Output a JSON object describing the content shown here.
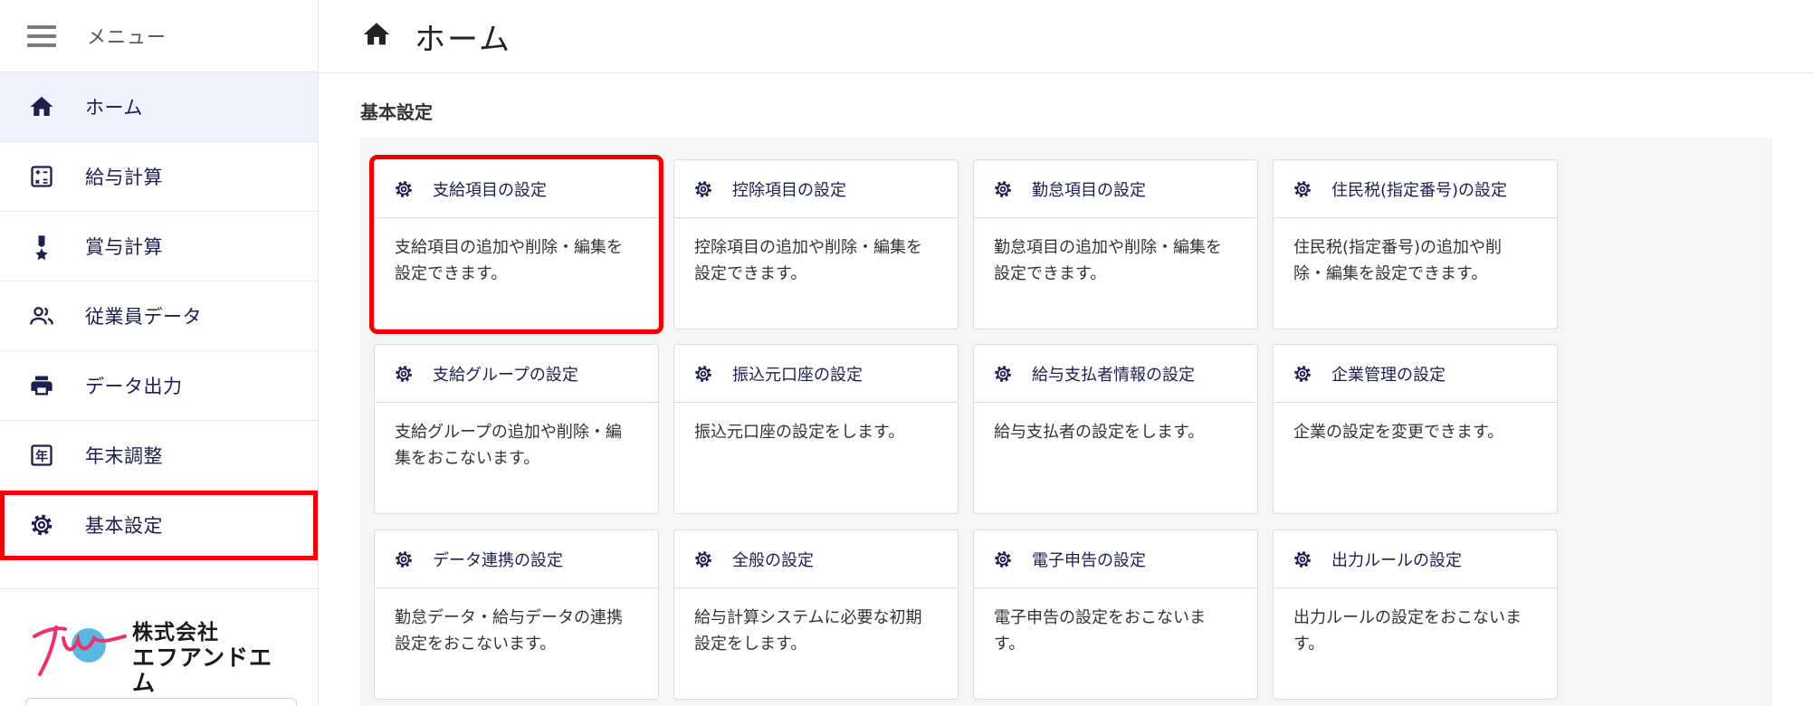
{
  "sidebar": {
    "menu_label": "メニュー",
    "items": [
      {
        "label": "ホーム",
        "icon": "home-icon"
      },
      {
        "label": "給与計算",
        "icon": "calculator-icon"
      },
      {
        "label": "賞与計算",
        "icon": "medal-icon"
      },
      {
        "label": "従業員データ",
        "icon": "people-icon"
      },
      {
        "label": "データ出力",
        "icon": "printer-icon"
      },
      {
        "label": "年末調整",
        "icon": "year-calendar-icon"
      },
      {
        "label": "基本設定",
        "icon": "gear-icon"
      }
    ],
    "active_index": 0,
    "logo_line1": "株式会社",
    "logo_line2": "エフアンドエム"
  },
  "header": {
    "title": "ホーム",
    "icon": "home-icon"
  },
  "main": {
    "section_title": "基本設定",
    "cards": [
      {
        "title": "支給項目の設定",
        "desc_1": "支給項目の追加や削除・編集を",
        "desc_2": "設定できます。"
      },
      {
        "title": "控除項目の設定",
        "desc_1": "控除項目の追加や削除・編集を",
        "desc_2": "設定できます。"
      },
      {
        "title": "勤怠項目の設定",
        "desc_1": "勤怠項目の追加や削除・編集を",
        "desc_2": "設定できます。"
      },
      {
        "title": "住民税(指定番号)の設定",
        "desc_1": "住民税(指定番号)の追加や削",
        "desc_2": "除・編集を設定できます。"
      },
      {
        "title": "支給グループの設定",
        "desc_1": "支給グループの追加や削除・編",
        "desc_2": "集をおこないます。"
      },
      {
        "title": "振込元口座の設定",
        "desc_1": "振込元口座の設定をします。",
        "desc_2": ""
      },
      {
        "title": "給与支払者情報の設定",
        "desc_1": "給与支払者の設定をします。",
        "desc_2": ""
      },
      {
        "title": "企業管理の設定",
        "desc_1": "企業の設定を変更できます。",
        "desc_2": ""
      },
      {
        "title": "データ連携の設定",
        "desc_1": "勤怠データ・給与データの連携",
        "desc_2": "設定をおこないます。"
      },
      {
        "title": "全般の設定",
        "desc_1": "給与計算システムに必要な初期",
        "desc_2": "設定をします。"
      },
      {
        "title": "電子申告の設定",
        "desc_1": "電子申告の設定をおこないま",
        "desc_2": "す。"
      },
      {
        "title": "出力ルールの設定",
        "desc_1": "出力ルールの設定をおこないま",
        "desc_2": "す。"
      }
    ]
  },
  "colors": {
    "nav_text": "#1d1f4d",
    "active_bg": "#eef3fe",
    "highlight": "#ee0000",
    "logo_pink": "#e8336d",
    "logo_blue": "#5bb8e0"
  }
}
